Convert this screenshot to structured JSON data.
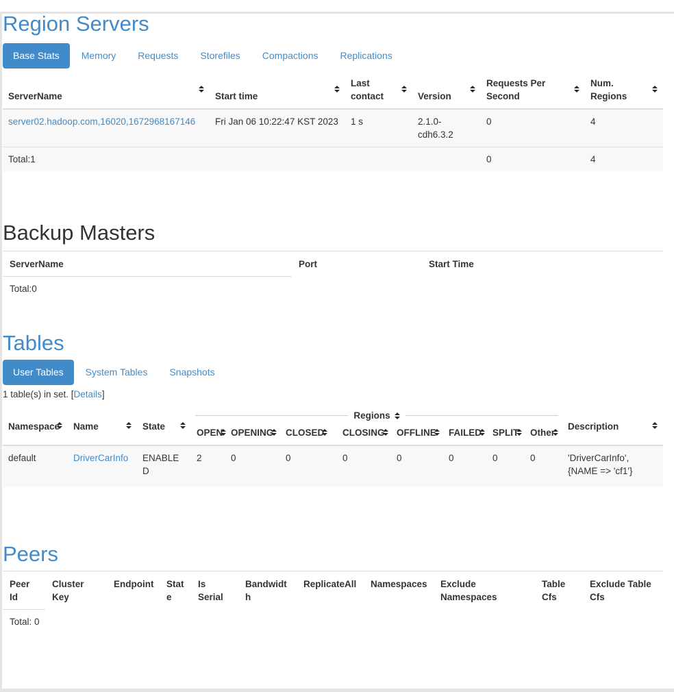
{
  "colors": {
    "accent": "#428bca",
    "heading_dark": "#333333",
    "text": "#333333",
    "border": "#dddddd",
    "row_stripe": "#f8f8f8",
    "active_tab_bg": "#428bca",
    "active_tab_text": "#ffffff"
  },
  "icons": {
    "sort": "sort-arrows"
  },
  "region_servers": {
    "title": "Region Servers",
    "tabs": [
      {
        "label": "Base Stats",
        "active": true
      },
      {
        "label": "Memory",
        "active": false
      },
      {
        "label": "Requests",
        "active": false
      },
      {
        "label": "Storefiles",
        "active": false
      },
      {
        "label": "Compactions",
        "active": false
      },
      {
        "label": "Replications",
        "active": false
      }
    ],
    "columns": [
      "ServerName",
      "Start time",
      "Last contact",
      "Version",
      "Requests Per Second",
      "Num. Regions"
    ],
    "rows": [
      {
        "server_name": "server02.hadoop.com,16020,1672968167146",
        "start_time": "Fri Jan 06 10:22:47 KST 2023",
        "last_contact": "1 s",
        "version": "2.1.0-cdh6.3.2",
        "requests_per_second": "0",
        "num_regions": "4"
      }
    ],
    "total": {
      "label": "Total:1",
      "requests_per_second": "0",
      "num_regions": "4"
    }
  },
  "backup_masters": {
    "title": "Backup Masters",
    "columns": [
      "ServerName",
      "Port",
      "Start Time"
    ],
    "total": "Total:0"
  },
  "tables": {
    "title": "Tables",
    "tabs": [
      {
        "label": "User Tables",
        "active": true
      },
      {
        "label": "System Tables",
        "active": false
      },
      {
        "label": "Snapshots",
        "active": false
      }
    ],
    "summary_prefix": "1 table(s) in set. [",
    "details_link": "Details",
    "summary_suffix": "]",
    "columns": [
      "Namespace",
      "Name",
      "State"
    ],
    "regions_group_label": "Regions",
    "region_columns": [
      "OPEN",
      "OPENING",
      "CLOSED",
      "CLOSING",
      "OFFLINE",
      "FAILED",
      "SPLIT",
      "Other"
    ],
    "description_column": "Description",
    "rows": [
      {
        "namespace": "default",
        "name": "DriverCarInfo",
        "state": "ENABLED",
        "open": "2",
        "opening": "0",
        "closed": "0",
        "closing": "0",
        "offline": "0",
        "failed": "0",
        "split": "0",
        "other": "0",
        "description": "'DriverCarInfo', {NAME => 'cf1'}"
      }
    ]
  },
  "peers": {
    "title": "Peers",
    "columns": [
      "Peer Id",
      "Cluster Key",
      "Endpoint",
      "State",
      "Is Serial",
      "Bandwidth",
      "ReplicateAll",
      "Namespaces",
      "Exclude Namespaces",
      "Table Cfs",
      "Exclude Table Cfs"
    ],
    "total": "Total: 0"
  }
}
